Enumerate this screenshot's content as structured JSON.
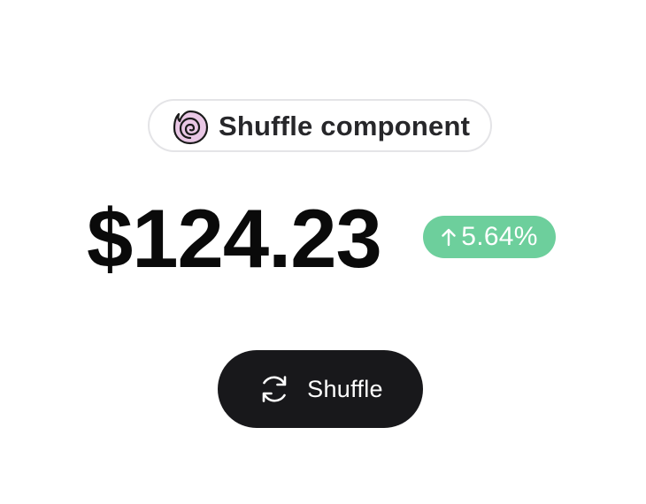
{
  "header": {
    "pill_label": "Shuffle component",
    "logo_icon": "spiral-shell-icon",
    "logo_fill": "#e9c7e5",
    "logo_stroke": "#1a1a1a"
  },
  "ticker": {
    "price": "$124.23",
    "change_percent": "5.64%",
    "change_direction": "up",
    "arrow_icon": "arrow-up-icon",
    "badge_color": "#6dcf9c"
  },
  "actions": {
    "shuffle_label": "Shuffle",
    "shuffle_icon": "refresh-icon",
    "button_color": "#18181b"
  }
}
